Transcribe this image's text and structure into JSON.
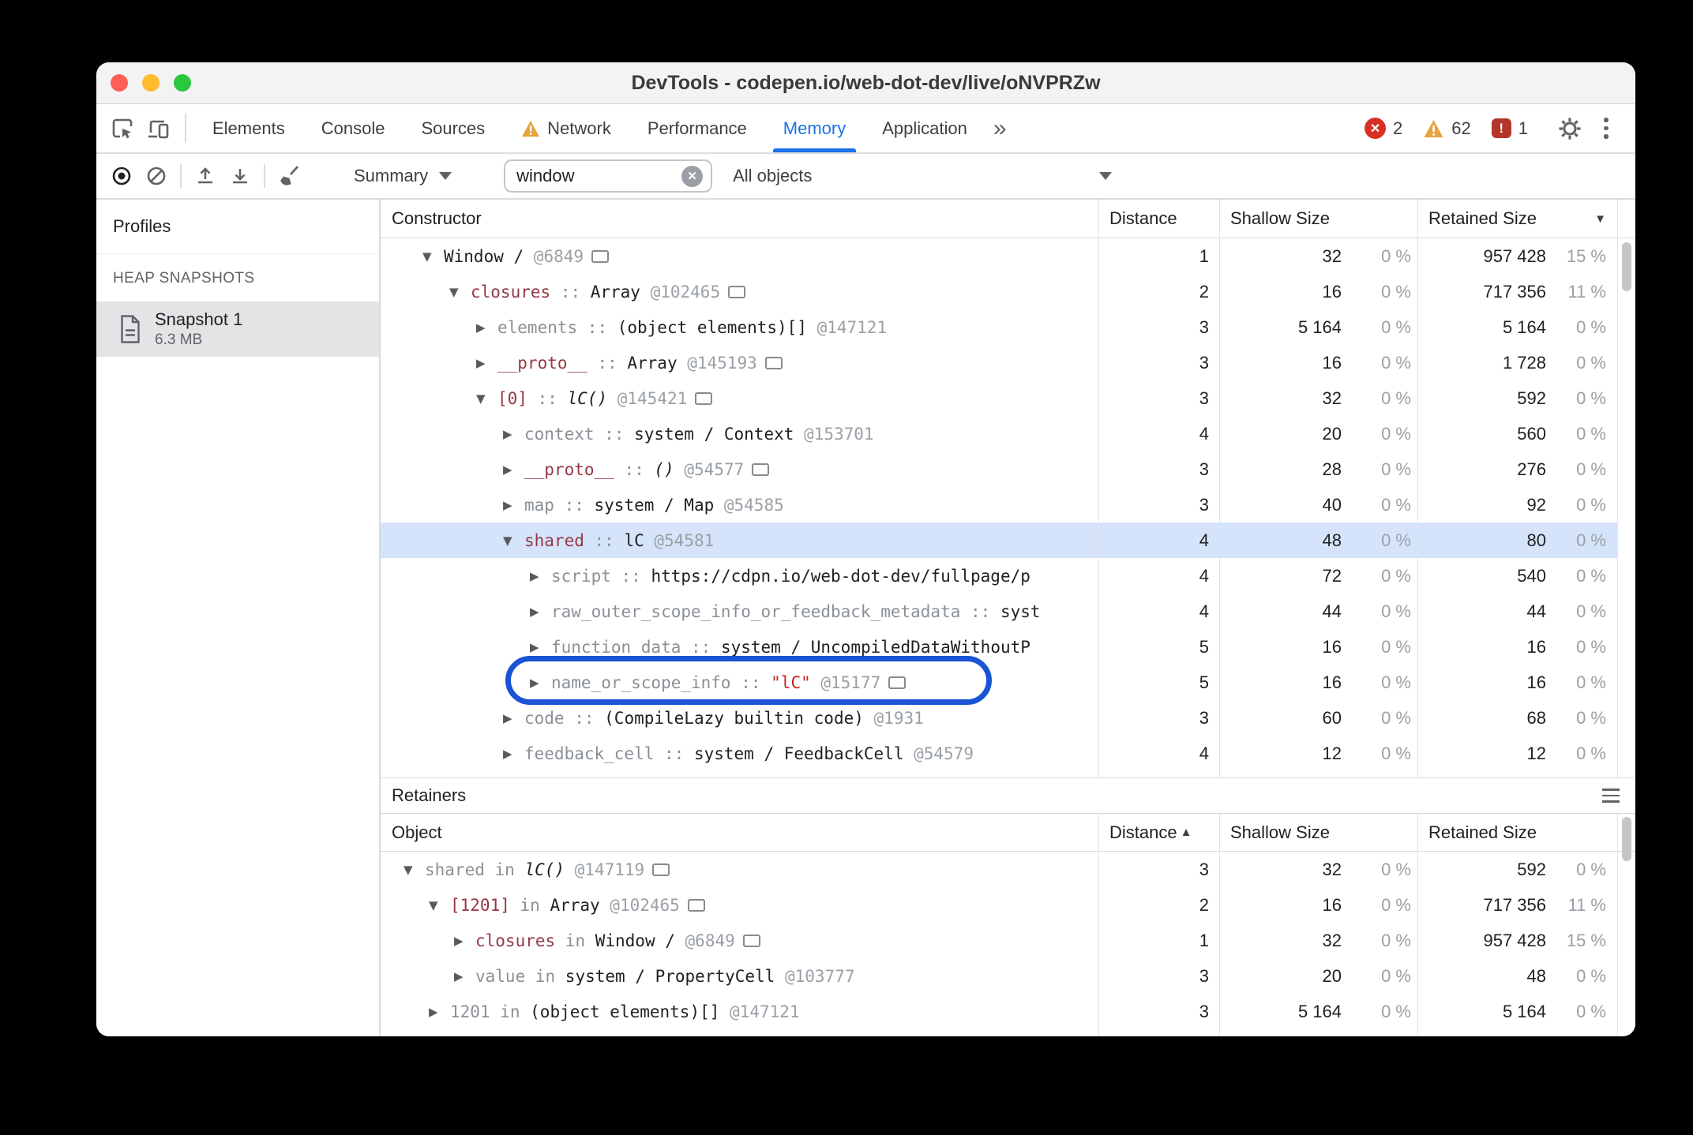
{
  "colors": {
    "accent": "#1a73e8",
    "selection": "#d5e4fa",
    "annotation": "#1a53d4",
    "error": "#d93025",
    "warning": "#e8a33d",
    "issues": "#b3362b",
    "property": "#953844",
    "string": "#c5221f",
    "dim": "#8a9096",
    "id": "#9aa0a6"
  },
  "window": {
    "title": "DevTools - codepen.io/web-dot-dev/live/oNVPRZw"
  },
  "tabbar": {
    "tabs": [
      {
        "label": "Elements"
      },
      {
        "label": "Console"
      },
      {
        "label": "Sources"
      },
      {
        "label": "Network",
        "warning": true
      },
      {
        "label": "Performance"
      },
      {
        "label": "Memory",
        "active": true
      },
      {
        "label": "Application"
      }
    ],
    "more_symbol": "»",
    "badges": {
      "errors": "2",
      "warnings": "62",
      "issues": "1"
    }
  },
  "toolbar": {
    "view_select": "Summary",
    "search_value": "window",
    "filter_select": "All objects"
  },
  "sidebar": {
    "title": "Profiles",
    "section": "HEAP SNAPSHOTS",
    "snapshot": {
      "name": "Snapshot 1",
      "size": "6.3 MB"
    }
  },
  "constructor_table": {
    "headers": {
      "main": "Constructor",
      "distance": "Distance",
      "shallow": "Shallow Size",
      "retained": "Retained Size",
      "sort_desc": "▼"
    },
    "rows": [
      {
        "level": 0,
        "expanded": true,
        "name": "Window /",
        "name_style": "plain",
        "sep": "",
        "value": "",
        "id": "@6849",
        "icon": true,
        "distance": "1",
        "shallow": "32",
        "shallow_pct": "0 %",
        "retained": "957 428",
        "retained_pct": "15 %"
      },
      {
        "level": 1,
        "expanded": true,
        "name": "closures",
        "name_style": "prop",
        "sep": "::",
        "value": "Array",
        "id": "@102465",
        "icon": true,
        "distance": "2",
        "shallow": "16",
        "shallow_pct": "0 %",
        "retained": "717 356",
        "retained_pct": "11 %"
      },
      {
        "level": 2,
        "expanded": false,
        "name": "elements",
        "name_style": "dim",
        "sep": "::",
        "value": "(object elements)[]",
        "id": "@147121",
        "distance": "3",
        "shallow": "5 164",
        "shallow_pct": "0 %",
        "retained": "5 164",
        "retained_pct": "0 %"
      },
      {
        "level": 2,
        "expanded": false,
        "name": "__proto__",
        "name_style": "prop",
        "sep": "::",
        "value": "Array",
        "id": "@145193",
        "icon": true,
        "distance": "3",
        "shallow": "16",
        "shallow_pct": "0 %",
        "retained": "1 728",
        "retained_pct": "0 %"
      },
      {
        "level": 2,
        "expanded": true,
        "name": "[0]",
        "name_style": "prop",
        "sep": "::",
        "value": "lC()",
        "value_style": "italic",
        "id": "@145421",
        "icon": true,
        "distance": "3",
        "shallow": "32",
        "shallow_pct": "0 %",
        "retained": "592",
        "retained_pct": "0 %"
      },
      {
        "level": 3,
        "expanded": false,
        "name": "context",
        "name_style": "dim",
        "sep": "::",
        "value": "system / Context",
        "id": "@153701",
        "distance": "4",
        "shallow": "20",
        "shallow_pct": "0 %",
        "retained": "560",
        "retained_pct": "0 %"
      },
      {
        "level": 3,
        "expanded": false,
        "name": "__proto__",
        "name_style": "prop",
        "sep": "::",
        "value": "()",
        "value_style": "italic",
        "id": "@54577",
        "icon": true,
        "distance": "3",
        "shallow": "28",
        "shallow_pct": "0 %",
        "retained": "276",
        "retained_pct": "0 %"
      },
      {
        "level": 3,
        "expanded": false,
        "name": "map",
        "name_style": "dim",
        "sep": "::",
        "value": "system / Map",
        "id": "@54585",
        "distance": "3",
        "shallow": "40",
        "shallow_pct": "0 %",
        "retained": "92",
        "retained_pct": "0 %"
      },
      {
        "level": 3,
        "expanded": true,
        "name": "shared",
        "name_style": "prop",
        "sep": "::",
        "value": "lC",
        "id": "@54581",
        "selected": true,
        "distance": "4",
        "shallow": "48",
        "shallow_pct": "0 %",
        "retained": "80",
        "retained_pct": "0 %"
      },
      {
        "level": 4,
        "expanded": false,
        "name": "script",
        "name_style": "dim",
        "sep": "::",
        "value": "https://cdpn.io/web-dot-dev/fullpage/p",
        "distance": "4",
        "shallow": "72",
        "shallow_pct": "0 %",
        "retained": "540",
        "retained_pct": "0 %"
      },
      {
        "level": 4,
        "expanded": false,
        "name": "raw_outer_scope_info_or_feedback_metadata",
        "name_style": "dim",
        "sep": "::",
        "value": "syst",
        "distance": "4",
        "shallow": "44",
        "shallow_pct": "0 %",
        "retained": "44",
        "retained_pct": "0 %"
      },
      {
        "level": 4,
        "expanded": false,
        "name": "function_data",
        "name_style": "dim",
        "sep": "::",
        "value": "system / UncompiledDataWithoutP",
        "distance": "5",
        "shallow": "16",
        "shallow_pct": "0 %",
        "retained": "16",
        "retained_pct": "0 %"
      },
      {
        "level": 4,
        "expanded": false,
        "name": "name_or_scope_info",
        "name_style": "dim",
        "sep": "::",
        "value": "\"lC\"",
        "value_style": "string",
        "id": "@15177",
        "icon": true,
        "annotated": true,
        "distance": "5",
        "shallow": "16",
        "shallow_pct": "0 %",
        "retained": "16",
        "retained_pct": "0 %"
      },
      {
        "level": 3,
        "expanded": false,
        "name": "code",
        "name_style": "dim",
        "sep": "::",
        "value": "(CompileLazy builtin code)",
        "id": "@1931",
        "distance": "3",
        "shallow": "60",
        "shallow_pct": "0 %",
        "retained": "68",
        "retained_pct": "0 %"
      },
      {
        "level": 3,
        "expanded": false,
        "name": "feedback_cell",
        "name_style": "dim",
        "sep": "::",
        "value": "system / FeedbackCell",
        "id": "@54579",
        "distance": "4",
        "shallow": "12",
        "shallow_pct": "0 %",
        "retained": "12",
        "retained_pct": "0 %"
      }
    ]
  },
  "retainers": {
    "title": "Retainers",
    "headers": {
      "main": "Object",
      "distance": "Distance",
      "shallow": "Shallow Size",
      "retained": "Retained Size",
      "sort_asc": "▲"
    },
    "rows": [
      {
        "level": 0,
        "expanded": true,
        "name": "shared",
        "name_style": "dim",
        "sep": "in",
        "value": "lC()",
        "value_style": "italic",
        "id": "@147119",
        "icon": true,
        "distance": "3",
        "shallow": "32",
        "shallow_pct": "0 %",
        "retained": "592",
        "retained_pct": "0 %"
      },
      {
        "level": 1,
        "expanded": true,
        "name": "[1201]",
        "name_style": "prop",
        "sep": "in",
        "value": "Array",
        "id": "@102465",
        "icon": true,
        "distance": "2",
        "shallow": "16",
        "shallow_pct": "0 %",
        "retained": "717 356",
        "retained_pct": "11 %"
      },
      {
        "level": 2,
        "expanded": false,
        "name": "closures",
        "name_style": "prop",
        "sep": "in",
        "value": "Window /",
        "id": "@6849",
        "icon": true,
        "distance": "1",
        "shallow": "32",
        "shallow_pct": "0 %",
        "retained": "957 428",
        "retained_pct": "15 %"
      },
      {
        "level": 2,
        "expanded": false,
        "name": "value",
        "name_style": "dim",
        "sep": "in",
        "value": "system / PropertyCell",
        "id": "@103777",
        "distance": "3",
        "shallow": "20",
        "shallow_pct": "0 %",
        "retained": "48",
        "retained_pct": "0 %"
      },
      {
        "level": 1,
        "expanded": false,
        "name": "1201",
        "name_style": "dim",
        "sep": "in",
        "value": "(object elements)[]",
        "id": "@147121",
        "distance": "3",
        "shallow": "5 164",
        "shallow_pct": "0 %",
        "retained": "5 164",
        "retained_pct": "0 %"
      }
    ]
  }
}
